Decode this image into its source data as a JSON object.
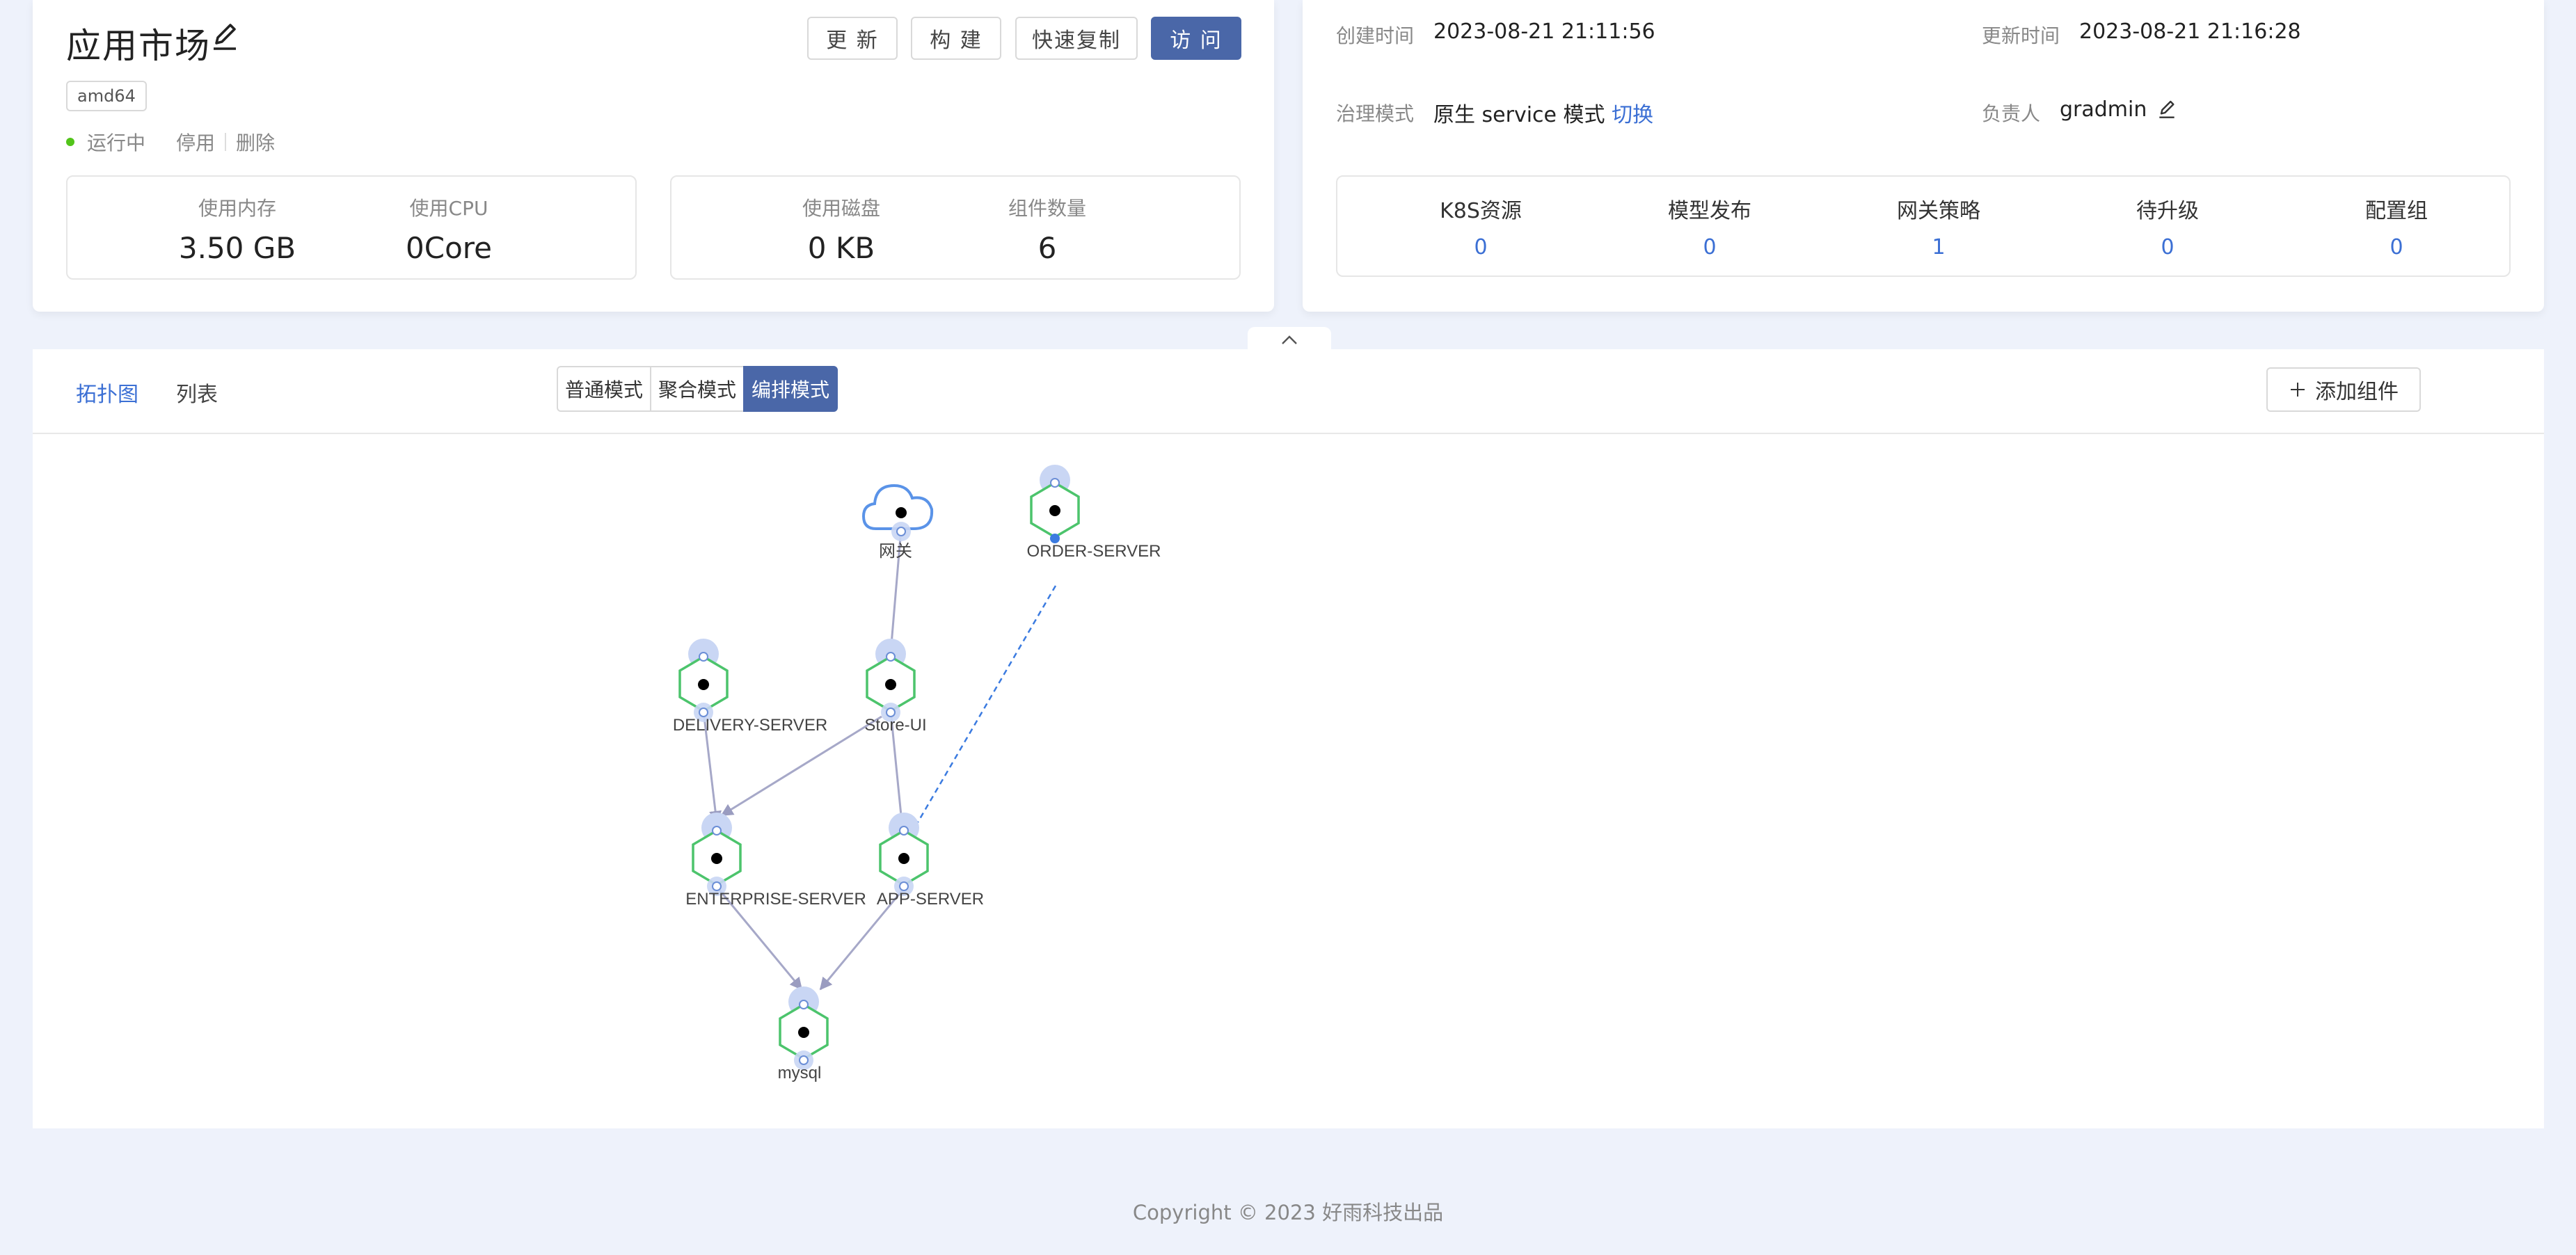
{
  "app": {
    "title": "应用市场",
    "arch": "amd64",
    "status": "运行中",
    "stop": "停用",
    "delete": "删除",
    "buttons": {
      "update": "更 新",
      "build": "构 建",
      "copy": "快速复制",
      "visit": "访 问"
    },
    "stats": {
      "memory_label": "使用内存",
      "memory_value": "3.50 GB",
      "cpu_label": "使用CPU",
      "cpu_value": "0Core",
      "disk_label": "使用磁盘",
      "disk_value": "0 KB",
      "components_label": "组件数量",
      "components_value": "6"
    }
  },
  "info": {
    "created_label": "创建时间",
    "created_value": "2023-08-21 21:11:56",
    "updated_label": "更新时间",
    "updated_value": "2023-08-21 21:16:28",
    "governance_label": "治理模式",
    "governance_value": "原生 service 模式",
    "governance_switch": "切换",
    "owner_label": "负责人",
    "owner_value": "gradmin",
    "resources": [
      {
        "label": "K8S资源",
        "value": "0"
      },
      {
        "label": "模型发布",
        "value": "0"
      },
      {
        "label": "网关策略",
        "value": "1"
      },
      {
        "label": "待升级",
        "value": "0"
      },
      {
        "label": "配置组",
        "value": "0"
      }
    ]
  },
  "topology": {
    "tabs": {
      "topology": "拓扑图",
      "list": "列表"
    },
    "modes": {
      "normal": "普通模式",
      "aggregate": "聚合模式",
      "orchestrate": "编排模式"
    },
    "add_component": "添加组件",
    "nodes": {
      "gateway": "网关",
      "order": "ORDER-SERVER",
      "delivery": "DELIVERY-SERVER",
      "storeui": "Store-UI",
      "enterprise": "ENTERPRISE-SERVER",
      "appserver": "APP-SERVER",
      "mysql": "mysql"
    }
  },
  "footer": "Copyright © 2023 好雨科技出品"
}
